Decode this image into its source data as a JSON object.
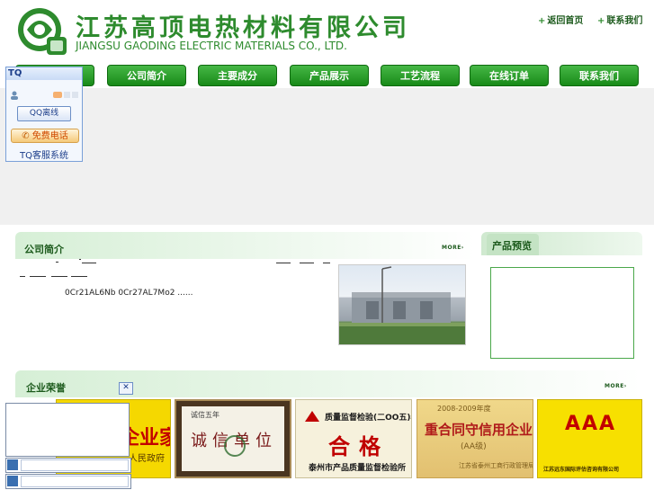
{
  "header": {
    "title_cn": "江苏高顶电热材料有限公司",
    "title_en": "JIANGSU GAODING ELECTRIC MATERIALS CO., LTD.",
    "links": [
      {
        "label": "返回首页"
      },
      {
        "label": "联系我们"
      }
    ]
  },
  "nav": {
    "items": [
      {
        "label": "公司简介"
      },
      {
        "label": "主要成分"
      },
      {
        "label": "产品展示"
      },
      {
        "label": "工艺流程"
      },
      {
        "label": "在线订单"
      },
      {
        "label": "联系我们"
      }
    ]
  },
  "tq": {
    "title": "TQ",
    "qq_button": "QQ离线",
    "phone_button": "免费电话",
    "system_label": "TQ客服系统"
  },
  "intro": {
    "title": "公司简介",
    "more": "MORE›",
    "text": "0Cr21AL6Nb 0Cr27AL7Mo2 ......"
  },
  "preview": {
    "title": "产品预览"
  },
  "honors": {
    "title": "企业荣誉",
    "more": "MORE›",
    "certs": [
      {
        "line1": "企业家",
        "line2": "人民政府"
      },
      {
        "line1": "诚信单位",
        "line2": "诚信五年"
      },
      {
        "line1": "质量监督检验(二OO五)年",
        "line2": "合格",
        "line3": "泰州市产品质量监督检验所"
      },
      {
        "line1": "2008-2009年度",
        "line2": "重合同守信用企业",
        "line3": "(AA级)",
        "line4": "江苏省泰州工商行政管理局"
      },
      {
        "line1": "AAA",
        "line2": "江苏远东国际评估咨询有限公司"
      }
    ]
  },
  "colors": {
    "brand_green": "#2e8b2e",
    "nav_green": "#188a18",
    "tq_blue": "#1b3d8a"
  }
}
